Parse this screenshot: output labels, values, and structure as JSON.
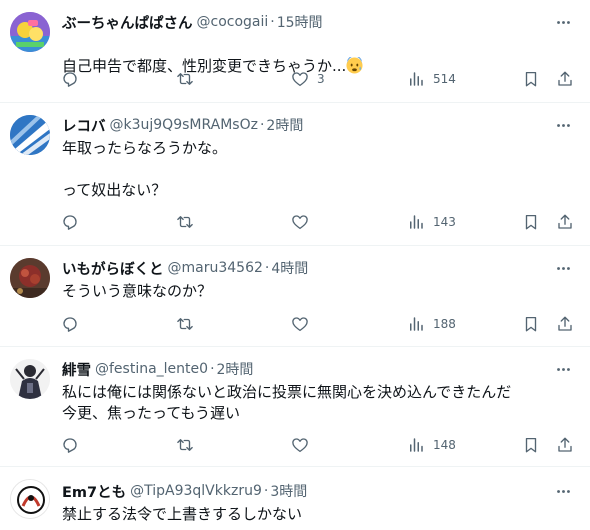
{
  "tweets": [
    {
      "name": "ぶーちゃんぱぱさん",
      "handle": "@cocogaii",
      "sep": "·",
      "time": "15時間",
      "text": "自己申告で都度、性別変更できちゃうか...",
      "emoji": "anxious-face",
      "reply_count": "",
      "retweet_count": "",
      "like_count": "3",
      "view_count": "514"
    },
    {
      "name": "レコバ",
      "handle": "@k3uj9Q9sMRAMsOz",
      "sep": "·",
      "time": "2時間",
      "text": "年取ったらなろうかな。\n\nって奴出ない？",
      "reply_count": "",
      "retweet_count": "",
      "like_count": "",
      "view_count": "143"
    },
    {
      "name": "いもがらぼくと",
      "handle": "@maru34562",
      "sep": "·",
      "time": "4時間",
      "text": "そういう意味なのか？",
      "reply_count": "",
      "retweet_count": "",
      "like_count": "",
      "view_count": "188"
    },
    {
      "name": "緋雪",
      "handle": "@festina_lente0",
      "sep": "·",
      "time": "2時間",
      "text": "私には俺には関係ないと政治に投票に無関心を決め込んできたんだ\n今更、焦ったってもう遅い",
      "reply_count": "",
      "retweet_count": "",
      "like_count": "",
      "view_count": "148"
    },
    {
      "name": "Em7とも",
      "handle": "@TipA93qlVkkzru9",
      "sep": "·",
      "time": "3時間",
      "text": "禁止する法令で上書きするしかない"
    }
  ],
  "colors": {
    "text_primary": "#0f1419",
    "text_secondary": "#536471",
    "divider": "#eff3f4"
  }
}
